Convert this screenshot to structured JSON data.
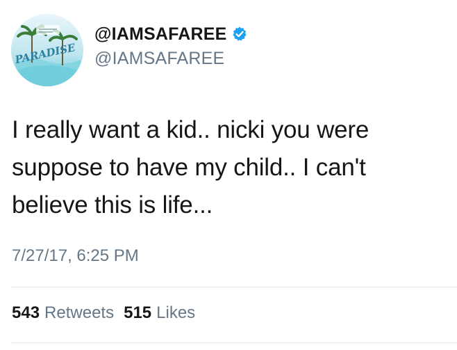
{
  "tweet": {
    "display_name": "@IAMSAFAREE",
    "handle": "@IAMSAFAREE",
    "verified": true,
    "text": "I really want a kid.. nicki you were\nsuppose to have my child.. I can't\nbelieve this is life...",
    "timestamp": "7/27/17, 6:25 PM",
    "retweets_count": "543",
    "retweets_label": "Retweets",
    "likes_count": "515",
    "likes_label": "Likes"
  },
  "avatar": {
    "text": "PARADISE"
  },
  "colors": {
    "verified_blue": "#1da1f2",
    "secondary_text": "#657786",
    "primary_text": "#14171a",
    "divider": "#e1e8ed"
  },
  "icons": {
    "verified": "verified-badge-icon"
  }
}
